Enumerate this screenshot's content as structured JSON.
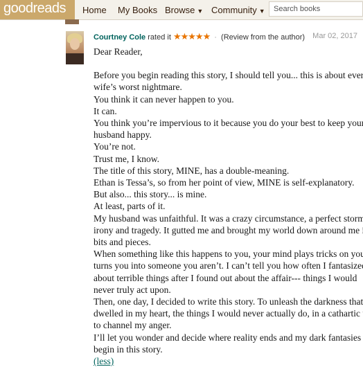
{
  "nav": {
    "logo": "goodreads",
    "items": [
      "Home",
      "My Books",
      "Browse",
      "Community"
    ],
    "search_placeholder": "Search books"
  },
  "review": {
    "user": "Courtney Cole",
    "rated_it": "rated it",
    "rating": 5,
    "stars": "★★★★★",
    "note": "(Review from the author)",
    "date": "Mar 02, 2017",
    "greeting": "Dear Reader,",
    "lines": [
      "Before you begin reading this story, I should tell you... this is about every",
      "wife’s worst nightmare.",
      "You think it can never happen to you.",
      "It can.",
      "You think you’re impervious to it because you do your best to keep your",
      "husband happy.",
      "You’re not.",
      "Trust me, I know.",
      "The title of this story, MINE, has a double-meaning.",
      "Ethan is Tessa’s, so from her point of view, MINE is self-explanatory.",
      "But also... this story... is mine.",
      "At least, parts of it.",
      "My husband was unfaithful. It was a crazy circumstance, a perfect storm of",
      "irony and tragedy. It gutted me and brought my world down around me in",
      "bits and pieces.",
      "When something like this happens to you, your mind plays tricks on you and",
      "turns you into someone you aren’t. I can’t tell you how often I fantasized",
      "about terrible things after I found out about the affair--- things I would",
      "never truly act upon.",
      "Then, one day, I decided to write this story. To unleash the darkness that",
      "dwelled in my heart, the things I would never actually do, in a cathartic way",
      "to channel my anger.",
      "I’ll let you wonder and decide where reality ends and my dark fantasies",
      "begin in this story."
    ],
    "less_link": "(less)"
  },
  "colors": {
    "topbar": "#f4f1ea",
    "logo_bg": "#cba86b",
    "link": "#00635d",
    "star": "#e87400"
  }
}
